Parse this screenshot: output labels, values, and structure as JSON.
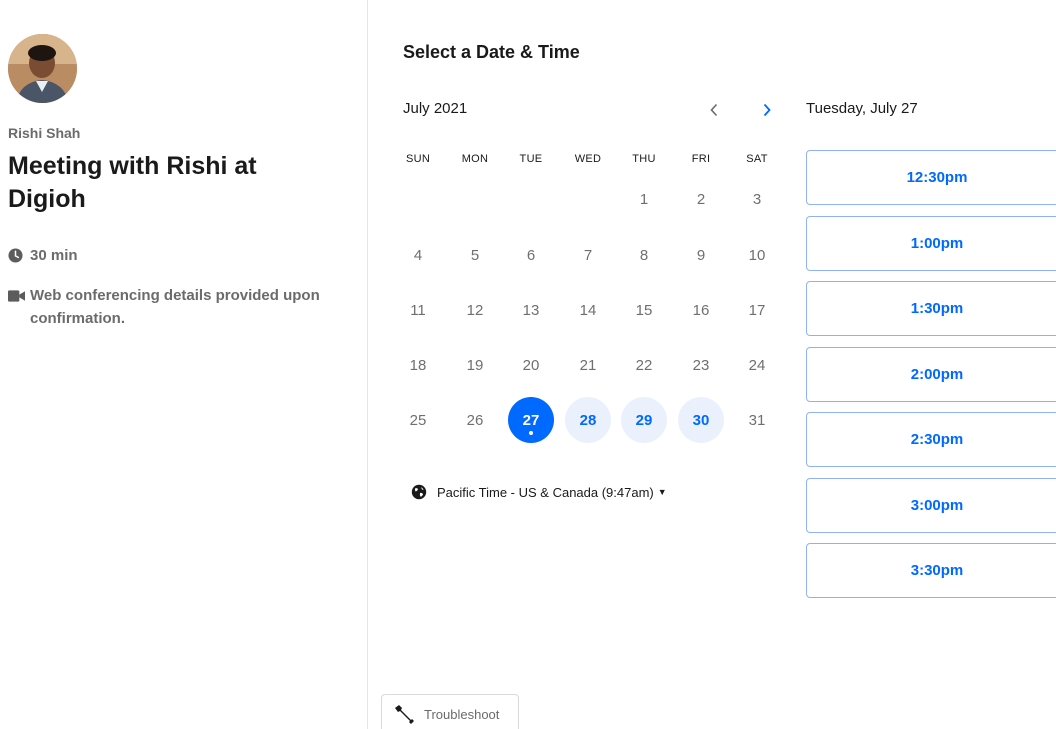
{
  "host": {
    "name": "Rishi Shah"
  },
  "event": {
    "title": "Meeting with Rishi at Digioh",
    "duration": "30 min",
    "conferencing": "Web conferencing details provided upon confirmation."
  },
  "calendar": {
    "heading": "Select a Date & Time",
    "month": "July 2021",
    "weekdays": [
      "SUN",
      "MON",
      "TUE",
      "WED",
      "THU",
      "FRI",
      "SAT"
    ],
    "weeks": [
      [
        "",
        "",
        "",
        "",
        "1",
        "2",
        "3"
      ],
      [
        "4",
        "5",
        "6",
        "7",
        "8",
        "9",
        "10"
      ],
      [
        "11",
        "12",
        "13",
        "14",
        "15",
        "16",
        "17"
      ],
      [
        "18",
        "19",
        "20",
        "21",
        "22",
        "23",
        "24"
      ],
      [
        "25",
        "26",
        "27",
        "28",
        "29",
        "30",
        "31"
      ]
    ],
    "selected_day": "27",
    "available_days": [
      "28",
      "29",
      "30"
    ]
  },
  "timezone": {
    "label": "Pacific Time - US & Canada (9:47am)"
  },
  "slots": {
    "date_label": "Tuesday, July 27",
    "times": [
      "12:30pm",
      "1:00pm",
      "1:30pm",
      "2:00pm",
      "2:30pm",
      "3:00pm",
      "3:30pm"
    ]
  },
  "troubleshoot": {
    "label": "Troubleshoot"
  },
  "colors": {
    "accent": "#0069ff",
    "available_bg": "#ebf1fc",
    "muted_text": "#6b6b6b"
  }
}
